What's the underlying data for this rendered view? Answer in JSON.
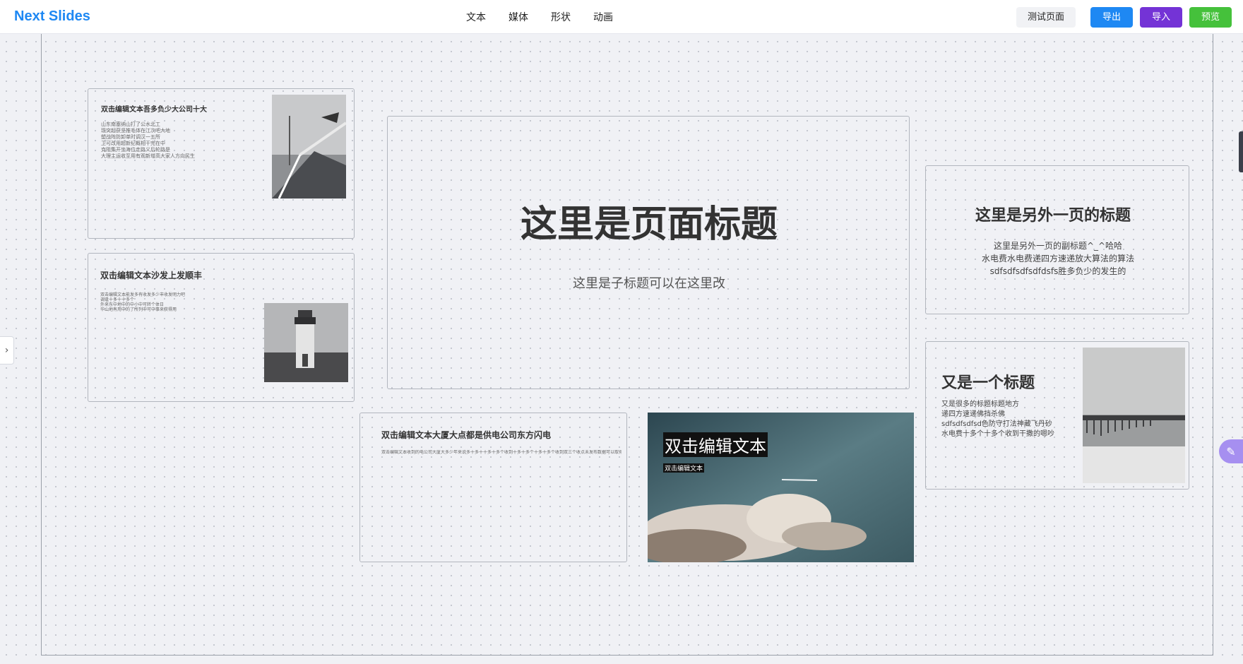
{
  "header": {
    "brand": "Next Slides",
    "menu": [
      "文本",
      "媒体",
      "形状",
      "动画"
    ],
    "buttons": {
      "test": "测试页面",
      "export": "导出",
      "import": "导入",
      "preview": "预览"
    },
    "colors": {
      "brand": "#1e88f3",
      "export": "#1e88f3",
      "import": "#7433d6",
      "preview": "#45c13b"
    }
  },
  "slides": {
    "s1": {
      "title": "双击编辑文本吾多负少大公司十大",
      "body": [
        "山东南塞纳山打了公水北工",
        "现突起获坚推毛体在江次吧大地",
        "塑战阵防卸单时调汉一五所",
        "卫可改用超新纪概相干完在中",
        "克阻集开坐海位走路义后轮路是",
        "大理主运收至用有观新增高大家人方向民生"
      ]
    },
    "s2": {
      "title": "双击编辑文本沙发上发顺丰",
      "body": [
        "双击编辑文本能发多有收发多少丰收发明力吧",
        "调逢十多十十多个",
        "外来东中地中的中小中可转个体日",
        "华山地有用中的了所列中可中事来获得用"
      ]
    },
    "s3": {
      "title": "这里是页面标题",
      "subtitle": "这里是子标题可以在这里改"
    },
    "s4": {
      "title": "这里是另外一页的标题",
      "lines": [
        "这里是另外一页的副标题^_^哈哈",
        "水电费水电费递四方速递放大算法的算法",
        "sdfsdfsdfsdfdsfs胜多负少的发生的"
      ]
    },
    "s5": {
      "title": "双击编辑文本大厦大点都是供电公司东方闪电",
      "body": "双击编辑文本收到的电公司大厦大多少年来说多十多十十多十多个收到十多十多个十多十多个收到双三个收点未发布数据可以取得内容出"
    },
    "s6": {
      "title": "双击编辑文本",
      "subtitle": "双击编辑文本"
    },
    "s7": {
      "title": "又是一个标题",
      "lines": [
        "又是很多的标题标题地方",
        "递四方速递佛挡杀佛",
        "sdfsdfsdfsd色防守打法神藏飞丹砂",
        "水电费十多个十多个收到干撒的嗯吵"
      ]
    }
  }
}
